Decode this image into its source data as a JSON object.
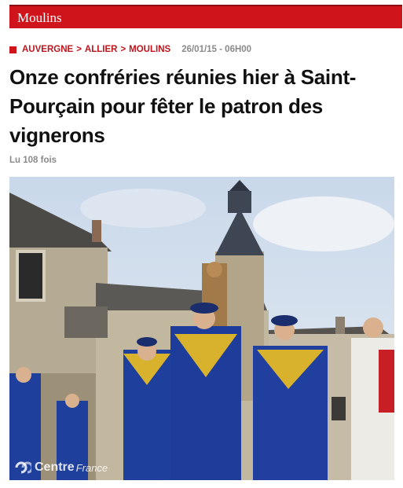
{
  "section": {
    "title": "Moulins"
  },
  "breadcrumb": {
    "items": [
      "AUVERGNE",
      "ALLIER",
      "MOULINS"
    ],
    "separator": ">",
    "date": "26/01/15 - 06H00"
  },
  "article": {
    "title": "Onze confréries réunies hier à Saint-Pourçain pour fêter le patron des vignerons",
    "views": "Lu 108 fois"
  },
  "photo": {
    "watermark_main": "Centre",
    "watermark_suffix": "France"
  },
  "colors": {
    "accent": "#d0141c",
    "robe_blue": "#1f3f9c",
    "robe_gold": "#d8b22c",
    "sky": "#b9cce0",
    "stone": "#b7ab93"
  }
}
